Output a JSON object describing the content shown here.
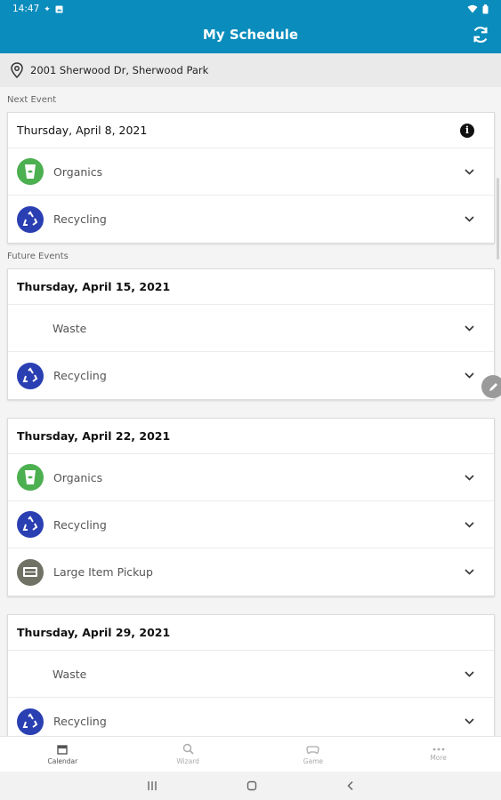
{
  "status": {
    "time": "14:47"
  },
  "header": {
    "title": "My Schedule"
  },
  "address": "2001 Sherwood Dr, Sherwood Park",
  "sections": {
    "next_label": "Next Event",
    "future_label": "Future Events"
  },
  "next_event": {
    "date": "Thursday, April 8, 2021",
    "items": [
      {
        "label": "Organics",
        "icon": "organics-icon"
      },
      {
        "label": "Recycling",
        "icon": "recycling-icon"
      }
    ]
  },
  "future_events": [
    {
      "date": "Thursday, April 15, 2021",
      "items": [
        {
          "label": "Waste"
        },
        {
          "label": "Recycling"
        }
      ]
    },
    {
      "date": "Thursday, April 22, 2021",
      "items": [
        {
          "label": "Organics"
        },
        {
          "label": "Recycling"
        },
        {
          "label": "Large Item Pickup"
        }
      ]
    },
    {
      "date": "Thursday, April 29, 2021",
      "items": [
        {
          "label": "Waste"
        },
        {
          "label": "Recycling"
        }
      ]
    }
  ],
  "tabs": [
    {
      "label": "Calendar",
      "icon": "calendar-icon",
      "active": true
    },
    {
      "label": "Wizard",
      "icon": "wizard-search-icon"
    },
    {
      "label": "Game",
      "icon": "game-controller-icon"
    },
    {
      "label": "More",
      "icon": "more-dots-icon"
    }
  ],
  "colors": {
    "appbar": "#0a8cbc",
    "organics": "#4caf50",
    "recycling": "#2a3fb2",
    "large_item": "#6f7265"
  }
}
